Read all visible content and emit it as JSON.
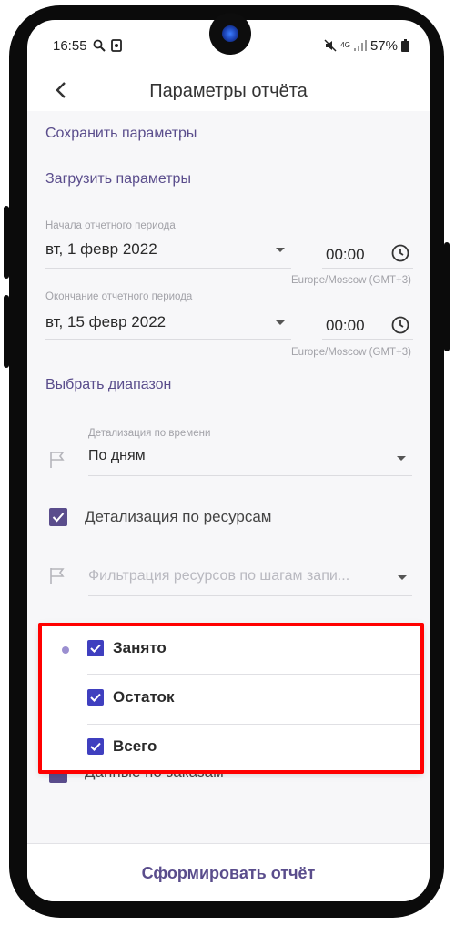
{
  "status_bar": {
    "time": "16:55",
    "battery": "57%",
    "network": "4G"
  },
  "header": {
    "title": "Параметры отчёта",
    "back_icon": "chevron-left-icon"
  },
  "actions": {
    "save_params": "Сохранить параметры",
    "load_params": "Загрузить параметры",
    "choose_range": "Выбрать диапазон"
  },
  "period_start": {
    "label": "Начала отчетного периода",
    "date": "вт, 1 февр 2022",
    "time": "00:00",
    "timezone": "Europe/Moscow (GMT+3)"
  },
  "period_end": {
    "label": "Окончание отчетного периода",
    "date": "вт, 15 февр 2022",
    "time": "00:00",
    "timezone": "Europe/Moscow (GMT+3)"
  },
  "time_detail": {
    "label": "Детализация по времени",
    "value": "По дням"
  },
  "resource_detail": {
    "label": "Детализация по ресурсам",
    "checked": true
  },
  "resource_filter": {
    "placeholder": "Фильтрация ресурсов по шагам запи..."
  },
  "behind_menu_text": "Данные по заказам",
  "menu": {
    "items": [
      {
        "label": "Занято",
        "checked": true
      },
      {
        "label": "Остаток",
        "checked": true
      },
      {
        "label": "Всего",
        "checked": true
      }
    ]
  },
  "bottom": {
    "generate_button": "Сформировать отчёт"
  },
  "colors": {
    "accent": "#5a4d8c",
    "checkbox": "#3f3fbf",
    "highlight": "#ff0000"
  }
}
